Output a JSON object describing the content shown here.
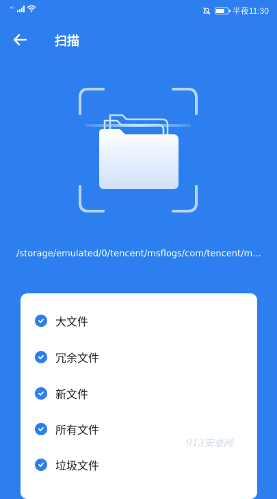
{
  "status_bar": {
    "signal_label": "⁴ᴳ",
    "time": "半夜11:30"
  },
  "header": {
    "title": "扫描"
  },
  "scan": {
    "path": "/storage/emulated/0/tencent/msflogs/com/tencent/mob..."
  },
  "options": [
    {
      "label": "大文件",
      "checked": true
    },
    {
      "label": "冗余文件",
      "checked": true
    },
    {
      "label": "新文件",
      "checked": true
    },
    {
      "label": "所有文件",
      "checked": true
    },
    {
      "label": "垃圾文件",
      "checked": true
    }
  ],
  "watermark": "913安卓网",
  "colors": {
    "background": "#2d7ff0",
    "card": "#ffffff",
    "check": "#2d7ff0",
    "text_dark": "#222222"
  }
}
